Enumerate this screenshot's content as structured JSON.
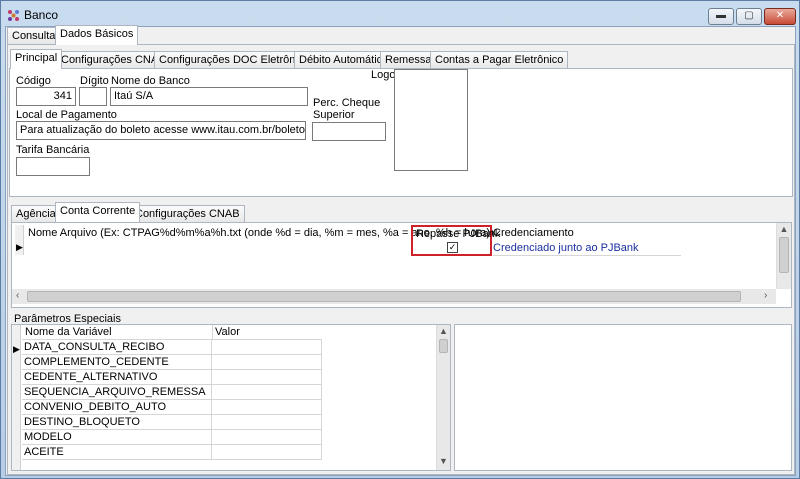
{
  "window": {
    "title": "Banco",
    "buttons": {
      "minimize": "▬",
      "maximize": "▢",
      "close": "✕"
    }
  },
  "top_tabs": [
    "Consulta",
    "Dados Básicos"
  ],
  "sub_tabs": [
    "Principal",
    "Configurações CNAB",
    "Configurações DOC Eletrônico",
    "Débito Automático",
    "Remessa",
    "Contas a Pagar Eletrônico"
  ],
  "principal": {
    "codigo_label": "Código",
    "codigo_value": "341",
    "digito_label": "Dígito",
    "digito_value": "",
    "nome_label": "Nome do Banco",
    "nome_value": "Itaú S/A",
    "logo_label": "Logo",
    "perc_label_1": "Perc. Cheque",
    "perc_label_2": "Superior",
    "perc_value": "",
    "local_label": "Local de Pagamento",
    "local_value": "Para atualização do boleto acesse www.itau.com.br/boletos",
    "tarifa_label": "Tarifa Bancária",
    "tarifa_value": ""
  },
  "lower_tabs": [
    "Agência",
    "Conta Corrente",
    "Configurações CNAB"
  ],
  "conta_grid": {
    "col_nome_arquivo": "Nome Arquivo (Ex: CTPAG%d%m%a%h.txt (onde %d = dia, %m = mes, %a = ano, %h = hora))",
    "col_repasse": "Repasse PJBank",
    "col_credenciamento": "Credenciamento",
    "row_credenciamento": "Credenciado junto ao PJBank",
    "repasse_checked": true
  },
  "parametros": {
    "title": "Parâmetros Especiais",
    "col_variavel": "Nome da Variável",
    "col_valor": "Valor",
    "rows": [
      "DATA_CONSULTA_RECIBO",
      "COMPLEMENTO_CEDENTE",
      "CEDENTE_ALTERNATIVO",
      "SEQUENCIA_ARQUIVO_REMESSA",
      "CONVENIO_DEBITO_AUTO",
      "DESTINO_BLOQUETO",
      "MODELO",
      "ACEITE"
    ]
  },
  "colors": {
    "highlight_border": "#d0202a",
    "link_blue": "#1a2fa0"
  }
}
